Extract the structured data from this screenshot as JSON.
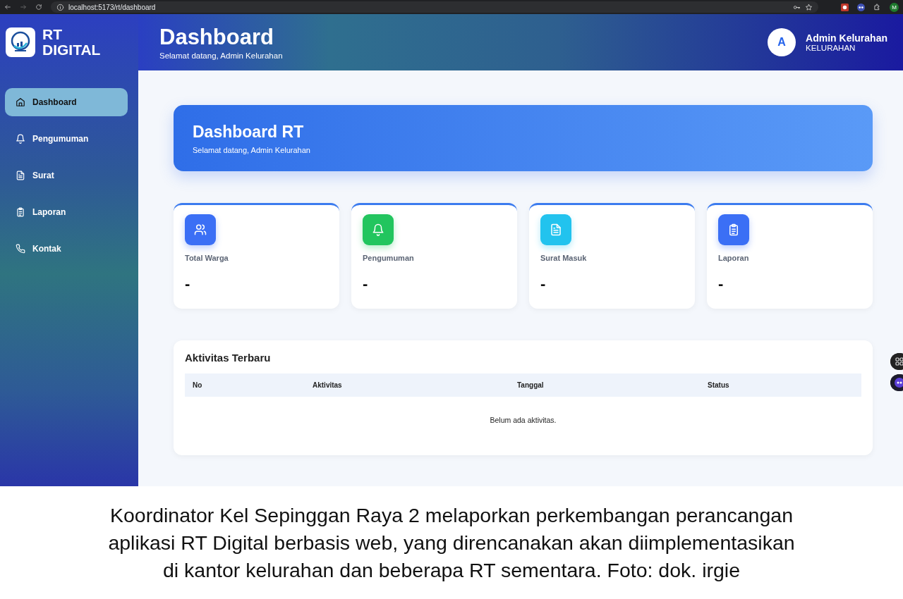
{
  "browser": {
    "url": "localhost:5173/rt/dashboard",
    "profile": "M"
  },
  "brand": {
    "line_1": "RT",
    "line_2": "DIGITAL"
  },
  "header": {
    "title": "Dashboard",
    "subtitle": "Selamat datang, Admin Kelurahan",
    "avatar": "A",
    "user_name": "Admin Kelurahan",
    "user_role": "KELURAHAN"
  },
  "sidebar": {
    "items": [
      {
        "label": "Dashboard",
        "kind": "home",
        "selected": true
      },
      {
        "label": "Pengumuman",
        "kind": "bell",
        "selected": false
      },
      {
        "label": "Surat",
        "kind": "document",
        "selected": false
      },
      {
        "label": "Laporan",
        "kind": "clipboard",
        "selected": false
      },
      {
        "label": "Kontak",
        "kind": "phone",
        "selected": false
      }
    ]
  },
  "banner": {
    "title": "Dashboard RT",
    "subtitle": "Selamat datang, Admin Kelurahan"
  },
  "stats": [
    {
      "label": "Total Warga",
      "value": "-",
      "kind": "people",
      "color": "#3b6ff5"
    },
    {
      "label": "Pengumuman",
      "value": "-",
      "kind": "bell",
      "color": "#22c55e"
    },
    {
      "label": "Surat Masuk",
      "value": "-",
      "kind": "document",
      "color": "#22c3ee"
    },
    {
      "label": "Laporan",
      "value": "-",
      "kind": "clipboard",
      "color": "#3b6ff5"
    }
  ],
  "activity": {
    "title": "Aktivitas Terbaru",
    "columns": [
      "No",
      "Aktivitas",
      "Tanggal",
      "Status"
    ],
    "empty_message": "Belum ada aktivitas."
  },
  "caption": {
    "lines": [
      "Koordinator Kel Sepinggan Raya 2 melaporkan perkembangan perancangan",
      "aplikasi RT Digital berbasis web, yang direncanakan akan diimplementasikan",
      "di kantor kelurahan dan beberapa RT sementara. Foto: dok. irgie"
    ]
  }
}
